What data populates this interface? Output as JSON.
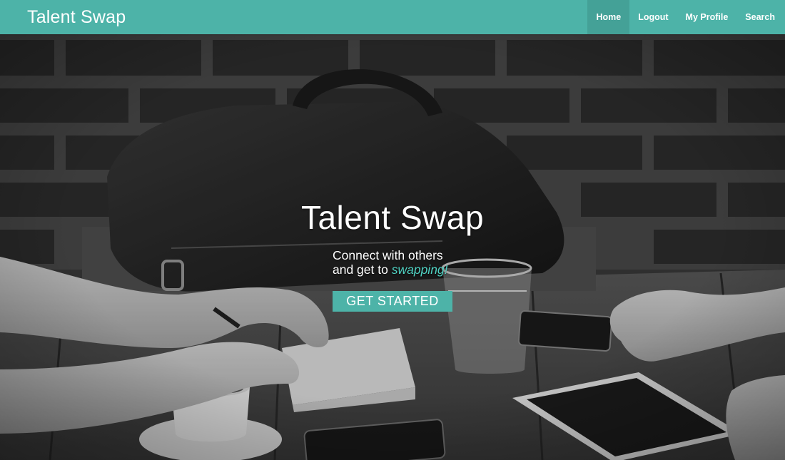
{
  "navbar": {
    "brand": "Talent Swap",
    "links": [
      {
        "label": "Home",
        "active": true
      },
      {
        "label": "Logout",
        "active": false
      },
      {
        "label": "My Profile",
        "active": false
      },
      {
        "label": "Search",
        "active": false
      }
    ]
  },
  "hero": {
    "title": "Talent Swap",
    "tagline_line1": "Connect with others",
    "tagline_line2_prefix": "and get to ",
    "tagline_line2_accent": "swapping!",
    "cta_label": "GET STARTED"
  },
  "colors": {
    "brand": "#4db3a8",
    "nav_active": "#44a197",
    "accent_text": "#4fd1c2"
  }
}
